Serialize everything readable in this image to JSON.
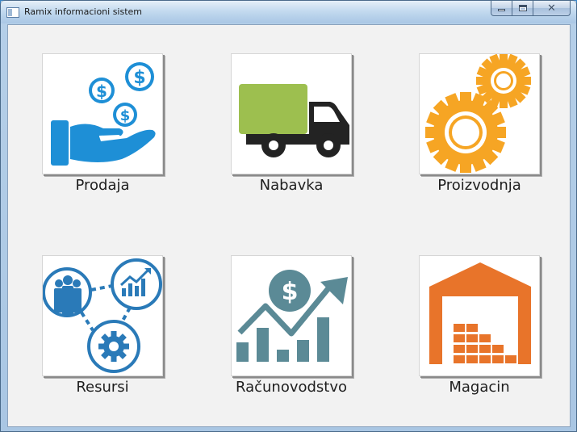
{
  "window": {
    "title": "Ramix informacioni sistem",
    "controls": {
      "minimize_icon": "minimize-icon",
      "maximize_icon": "maximize-icon",
      "close_icon": "close-icon"
    }
  },
  "modules": [
    {
      "label": "Prodaja",
      "icon": "money-hand-icon",
      "color": "#1e8fd6"
    },
    {
      "label": "Nabavka",
      "icon": "truck-icon",
      "color": "#9dbf4f"
    },
    {
      "label": "Proizvodnja",
      "icon": "gears-icon",
      "color": "#f6a524"
    },
    {
      "label": "Resursi",
      "icon": "team-growth-icon",
      "color": "#2a7ab8"
    },
    {
      "label": "Računovodstvo",
      "icon": "finance-chart-icon",
      "color": "#5b8a96"
    },
    {
      "label": "Magacin",
      "icon": "warehouse-icon",
      "color": "#e8742a"
    }
  ]
}
